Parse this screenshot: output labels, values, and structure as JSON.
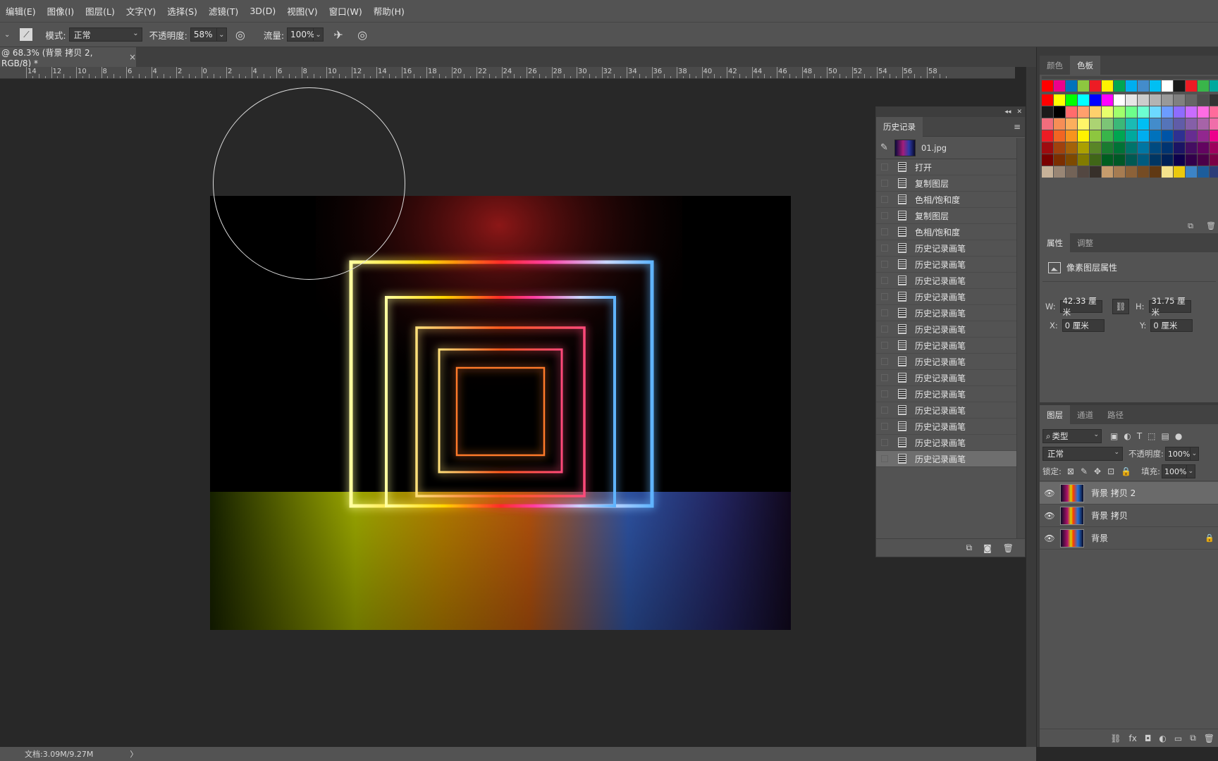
{
  "menu": [
    "编辑(E)",
    "图像(I)",
    "图层(L)",
    "文字(Y)",
    "选择(S)",
    "滤镜(T)",
    "3D(D)",
    "视图(V)",
    "窗口(W)",
    "帮助(H)"
  ],
  "options": {
    "mode_label": "模式:",
    "mode_value": "正常",
    "opacity_label": "不透明度:",
    "opacity_value": "58%",
    "flow_label": "流量:",
    "flow_value": "100%"
  },
  "document_tab": {
    "title": "@ 68.3% (背景 拷贝 2, RGB/8) *",
    "close": "×"
  },
  "ruler": [
    "14",
    "12",
    "10",
    "8",
    "6",
    "4",
    "2",
    "0",
    "2",
    "4",
    "6",
    "8",
    "10",
    "12",
    "14",
    "16",
    "18",
    "20",
    "22",
    "24",
    "26",
    "28",
    "30",
    "32",
    "34",
    "36",
    "38",
    "40",
    "42",
    "44",
    "46",
    "48",
    "50",
    "52",
    "54",
    "56",
    "58"
  ],
  "history": {
    "tab": "历史记录",
    "snapshot": "01.jpg",
    "items": [
      "打开",
      "复制图层",
      "色相/饱和度",
      "复制图层",
      "色相/饱和度",
      "历史记录画笔",
      "历史记录画笔",
      "历史记录画笔",
      "历史记录画笔",
      "历史记录画笔",
      "历史记录画笔",
      "历史记录画笔",
      "历史记录画笔",
      "历史记录画笔",
      "历史记录画笔",
      "历史记录画笔",
      "历史记录画笔",
      "历史记录画笔",
      "历史记录画笔"
    ],
    "selected_index": 18
  },
  "swatches": {
    "tabs": [
      "颜色",
      "色板"
    ],
    "active": "色板",
    "colors": [
      "#ff0000",
      "#ffff00",
      "#00ff00",
      "#00ffff",
      "#0000ff",
      "#ff00ff",
      "#ffffff",
      "#e6e6e6",
      "#cccccc",
      "#b3b3b3",
      "#999999",
      "#808080",
      "#666666",
      "#4d4d4d",
      "#333333",
      "#1a1a1a",
      "#000000",
      "#ff6c6c",
      "#ff9f6c",
      "#ffd06c",
      "#e7ff6c",
      "#a0ff6c",
      "#6cff8b",
      "#6cffd1",
      "#6cd8ff",
      "#6c9cff",
      "#8e6cff",
      "#c96cff",
      "#ff6ce3",
      "#ff6c9b",
      "#f26d7d",
      "#f68e56",
      "#fbaf5d",
      "#fff568",
      "#acd373",
      "#7cc576",
      "#3bb878",
      "#1abbb4",
      "#00bff3",
      "#438ccb",
      "#5574b9",
      "#605ca8",
      "#855fa8",
      "#a763a8",
      "#f06ea9",
      "#ed1c24",
      "#f26522",
      "#f7941d",
      "#fff200",
      "#8dc63f",
      "#39b54a",
      "#00a651",
      "#00a99d",
      "#00aeef",
      "#0072bc",
      "#0054a6",
      "#2e3192",
      "#662d91",
      "#92278f",
      "#ec008c",
      "#9e0b0f",
      "#a0410d",
      "#a36209",
      "#aba000",
      "#598527",
      "#1a7b30",
      "#007236",
      "#00746b",
      "#0076a3",
      "#004a80",
      "#003471",
      "#1b1464",
      "#440e62",
      "#630460",
      "#9e005d",
      "#790000",
      "#7b2e00",
      "#7d4900",
      "#827b00",
      "#406618",
      "#005e20",
      "#005826",
      "#005952",
      "#005b7f",
      "#003663",
      "#002157",
      "#0d004c",
      "#32004b",
      "#4b0049",
      "#7b0046",
      "#c7b299",
      "#998675",
      "#736357",
      "#534741",
      "#37302a",
      "#c69c6d",
      "#a67c52",
      "#8c6239",
      "#754c24",
      "#603913",
      "#f4e28c",
      "#ebc90e",
      "#3c84c6",
      "#1c5d9c",
      "#2e3c78"
    ],
    "top_row": [
      "#ff0000",
      "#ec008c",
      "#0072bc",
      "#8dc63f",
      "#ed1c24",
      "#fff200",
      "#00a651",
      "#00aeef",
      "#438ccb",
      "#00bff3",
      "#ffffff",
      "#1a1a1a",
      "#ed1c24",
      "#39b54a",
      "#00a99d"
    ]
  },
  "properties": {
    "tabs": [
      "属性",
      "调整"
    ],
    "active": "属性",
    "title": "像素图层属性",
    "w_label": "W:",
    "w_value": "42.33 厘米",
    "h_label": "H:",
    "h_value": "31.75 厘米",
    "x_label": "X:",
    "x_value": "0 厘米",
    "y_label": "Y:",
    "y_value": "0 厘米"
  },
  "layers": {
    "tabs": [
      "图层",
      "通道",
      "路径"
    ],
    "active": "图层",
    "filter_value": "类型",
    "blend_mode": "正常",
    "opacity_label": "不透明度:",
    "opacity_value": "100%",
    "lock_label": "锁定:",
    "fill_label": "填充:",
    "fill_value": "100%",
    "items": [
      {
        "name": "背景 拷贝 2",
        "selected": true,
        "locked": false
      },
      {
        "name": "背景 拷贝",
        "selected": false,
        "locked": false
      },
      {
        "name": "背景",
        "selected": false,
        "locked": true
      }
    ]
  },
  "status": {
    "doc_info": "文档:3.09M/9.27M",
    "arrow": "〉"
  }
}
